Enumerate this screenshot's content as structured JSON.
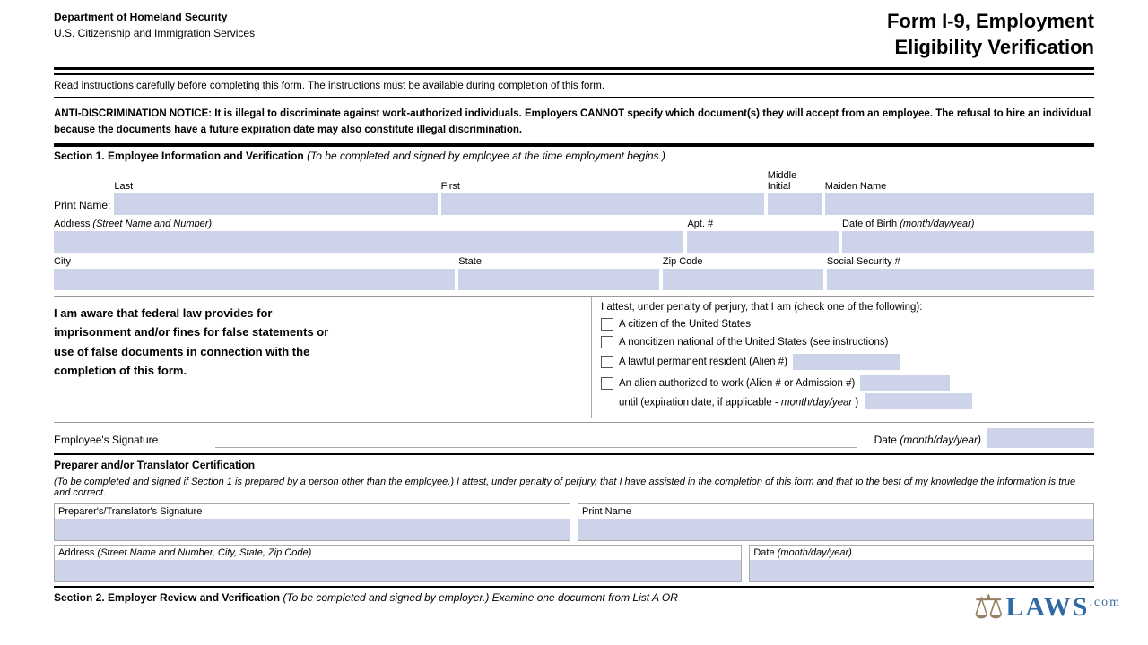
{
  "header": {
    "dept_name": "Department of Homeland Security",
    "dept_sub": "U.S. Citizenship and Immigration Services",
    "form_title_line1": "Form I-9, Employment",
    "form_title_line2": "Eligibility Verification"
  },
  "notices": {
    "read_notice": "Read instructions carefully before completing this form.  The instructions must be available during completion of this form.",
    "anti_disc": "ANTI-DISCRIMINATION NOTICE:  It is illegal to discriminate against work-authorized individuals. Employers CANNOT specify which document(s) they will accept from an employee.  The refusal to hire an individual because the documents have  a future expiration date may also constitute illegal discrimination."
  },
  "section1": {
    "header": "Section 1. Employee Information and Verification",
    "header_italic": "(To be completed and signed by employee at the time employment begins.)",
    "print_name_label": "Print Name:",
    "last_label": "Last",
    "first_label": "First",
    "middle_initial_label": "Middle Initial",
    "maiden_name_label": "Maiden Name",
    "address_label": "Address",
    "address_italic": "(Street Name and Number)",
    "apt_label": "Apt. #",
    "dob_label": "Date of Birth",
    "dob_italic": "(month/day/year)",
    "city_label": "City",
    "state_label": "State",
    "zip_label": "Zip Code",
    "ssn_label": "Social Security #",
    "awareness_text_1": "I am aware that federal law provides for",
    "awareness_text_2": "imprisonment and/or fines for false statements or",
    "awareness_text_3": "use of false documents in connection with the",
    "awareness_text_4": "completion of this form.",
    "attest_text": "I attest, under penalty of perjury, that I am (check one of the following):",
    "citizen_label": "A citizen of the United States",
    "noncitizen_label": "A noncitizen national of the United States (see instructions)",
    "resident_label": "A lawful permanent resident (Alien #)",
    "alien_auth_label": "An alien authorized to work (Alien # or Admission #)",
    "until_label": "until (expiration date, if applicable -",
    "until_italic": "month/day/year",
    "until_end": ")",
    "sig_label": "Employee's Signature",
    "date_label": "Date",
    "date_italic": "(month/day/year)"
  },
  "preparer": {
    "section_header": "Preparer and/or Translator Certification",
    "section_italic": "(To be completed and signed if Section 1 is prepared by a person other than the employee.) I attest, under penalty of perjury, that I have assisted in the completion of this form and that to the best of my knowledge the information is true and correct.",
    "sig_label": "Preparer's/Translator's Signature",
    "print_name_label": "Print Name",
    "address_label": "Address",
    "address_italic": "(Street Name and Number, City, State, Zip Code)",
    "date_label": "Date",
    "date_italic": "(month/day/year)"
  },
  "section2": {
    "header": "Section 2. Employer Review and Verification",
    "header_italic": "(To be completed and signed by employer.) Examine one document from List A OR"
  }
}
